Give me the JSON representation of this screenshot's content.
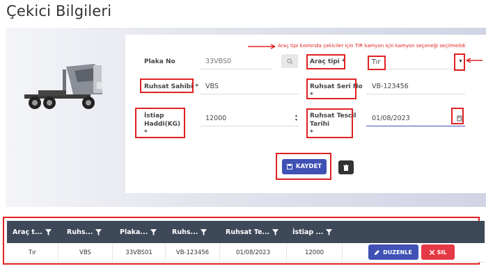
{
  "page": {
    "title": "Çekici Bilgileri"
  },
  "annotation": {
    "note": "Araç tipi kısmında çekiciler için TIR kamyon için kamyon seçeneği seçilmelidi"
  },
  "form": {
    "plaka_no": {
      "label": "Plaka No",
      "placeholder": "33VBS0"
    },
    "arac_tipi": {
      "label": "Araç tipi *",
      "value": "Tır"
    },
    "ruhsat_sahibi": {
      "label": "Ruhsat Sahibi *",
      "value": "VBS"
    },
    "ruhsat_seri_no": {
      "label_line1": "Ruhsat Seri No",
      "label_line2": "*",
      "value": "VB-123456"
    },
    "istiap_haddi": {
      "label_line1": "İstiap",
      "label_line2": "Haddi(KG)",
      "label_line3": "*",
      "value": "12000"
    },
    "ruhsat_tescil": {
      "label_line1": "Ruhsat Tescil",
      "label_line2": "Tarihi",
      "label_line3": "*",
      "value": "01/08/2023"
    },
    "save_label": "KAYDET"
  },
  "table": {
    "columns": [
      "Araç t...",
      "Ruhs...",
      "Plaka...",
      "Ruhs...",
      "Ruhsat Te...",
      "İstiap ..."
    ],
    "rows": [
      {
        "arac_tipi": "Tır",
        "ruhsat_sahibi": "VBS",
        "plaka": "33VBS01",
        "seri_no": "VB-123456",
        "tescil": "01/08/2023",
        "istiap": "12000"
      }
    ],
    "edit_label": "DUZENLE",
    "delete_label": "SIL"
  },
  "colors": {
    "primary": "#3f51b5",
    "danger": "#e53945",
    "annotation": "#e02020",
    "header": "#3d4858"
  },
  "icons": [
    "truck-icon",
    "search-icon",
    "chevron-down-icon",
    "calendar-icon",
    "save-icon",
    "trash-icon",
    "filter-icon",
    "pencil-icon",
    "close-icon",
    "arrow-icon"
  ]
}
